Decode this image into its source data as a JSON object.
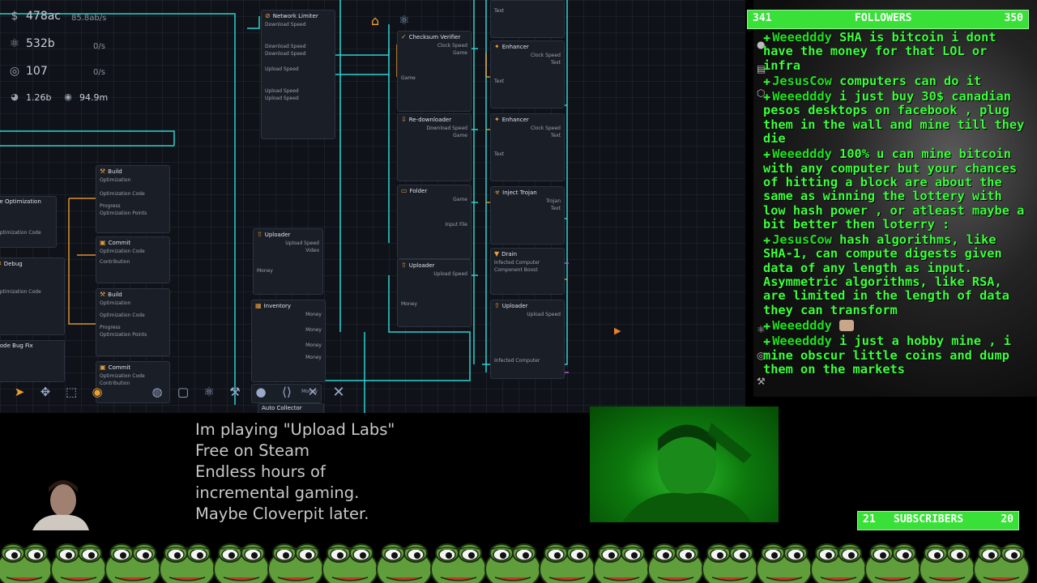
{
  "resources": [
    {
      "icon": "dollar-icon",
      "value": "478ac",
      "rate": "85.8ab/s"
    },
    {
      "icon": "atom-icon",
      "value": "532b",
      "rate": "0/s"
    },
    {
      "icon": "disc-icon",
      "value": "107",
      "rate": "0/s"
    }
  ],
  "stats": [
    {
      "icon": "pie-icon",
      "value": "1.26b"
    },
    {
      "icon": "target-icon",
      "value": "94.9m"
    }
  ],
  "nodes": {
    "network_limiter": "Network Limiter",
    "download_speed": "Download Speed",
    "upload_speed": "Upload Speed",
    "checksum_verifier": "Checksum Verifier",
    "enhancer_1": "Enhancer",
    "enhancer_2": "Enhancer",
    "re_downloader": "Re-downloader",
    "folder": "Folder",
    "inject_trojan": "Inject Trojan",
    "drain": "Drain",
    "uploader_1": "Uploader",
    "uploader_2": "Uploader",
    "uploader_3": "Uploader",
    "inventory": "Inventory",
    "build_1": "Build",
    "build_2": "Build",
    "commit_1": "Commit",
    "commit_2": "Commit",
    "code_optimization": "de Optimization",
    "debug": "Debug",
    "code_bug_fix": "Code Bug Fix",
    "auto_collector": "Auto Collector",
    "clock_speed": "Clock Speed",
    "game": "Game",
    "text": "Text",
    "money": "Money",
    "optimization": "Optimization",
    "optimization_code": "Optimization Code",
    "optimization_points": "Optimization Points",
    "contribution": "Contribution",
    "progress": "Progress",
    "infected_computer": "Infected Computer",
    "component_boost": "Component Boost",
    "trojan": "Trojan",
    "video": "Video",
    "input_file": "Input File"
  },
  "toolbar": {
    "tools": [
      "cursor-icon",
      "move-icon",
      "select-icon",
      "record-icon",
      "globe-icon",
      "square-icon",
      "atom-icon",
      "hammer-icon",
      "person-icon",
      "code-icon",
      "tools-icon",
      "close-icon"
    ]
  },
  "followers": {
    "left": "341",
    "label": "FOLLOWERS",
    "right": "350"
  },
  "chat": [
    {
      "user": "Weeedddy",
      "text": "SHA is bitcoin i dont have the money for that LOL or infra"
    },
    {
      "user": "JesusCow",
      "text": "computers can do it"
    },
    {
      "user": "Weeedddy",
      "text": "i just buy 30$ canadian pesos desktops on facebook , plug them in the wall and mine till they die"
    },
    {
      "user": "Weeedddy",
      "text": "100% u can mine bitcoin with any computer but your chances of hitting a block are about the same as winning the lottery with low hash power , or atleast maybe a bit better then loterry :"
    },
    {
      "user": "JesusCow",
      "text": "hash algorithms, like SHA-1, can compute digests given data of any length as input. Asymmetric algorithms, like RSA, are limited in the length of data they can transform"
    },
    {
      "user": "Weeedddy",
      "text": ""
    },
    {
      "user": "Weeedddy",
      "text": "i just a hobby mine , i mine obscur little coins and dump them on the markets"
    }
  ],
  "promo": [
    "Im playing \"Upload Labs\"",
    "Free on Steam",
    "Endless hours of",
    "incremental gaming.",
    "Maybe Cloverpit later."
  ],
  "subscribers": {
    "left": "21",
    "label": "SUBSCRIBERS",
    "right": "20"
  },
  "colors": {
    "chat_green": "#3cff3c",
    "wire_cyan": "#2ee6e6",
    "wire_orange": "#f0a030",
    "banner_green": "#38e038",
    "game_bg": "#0f1319"
  }
}
